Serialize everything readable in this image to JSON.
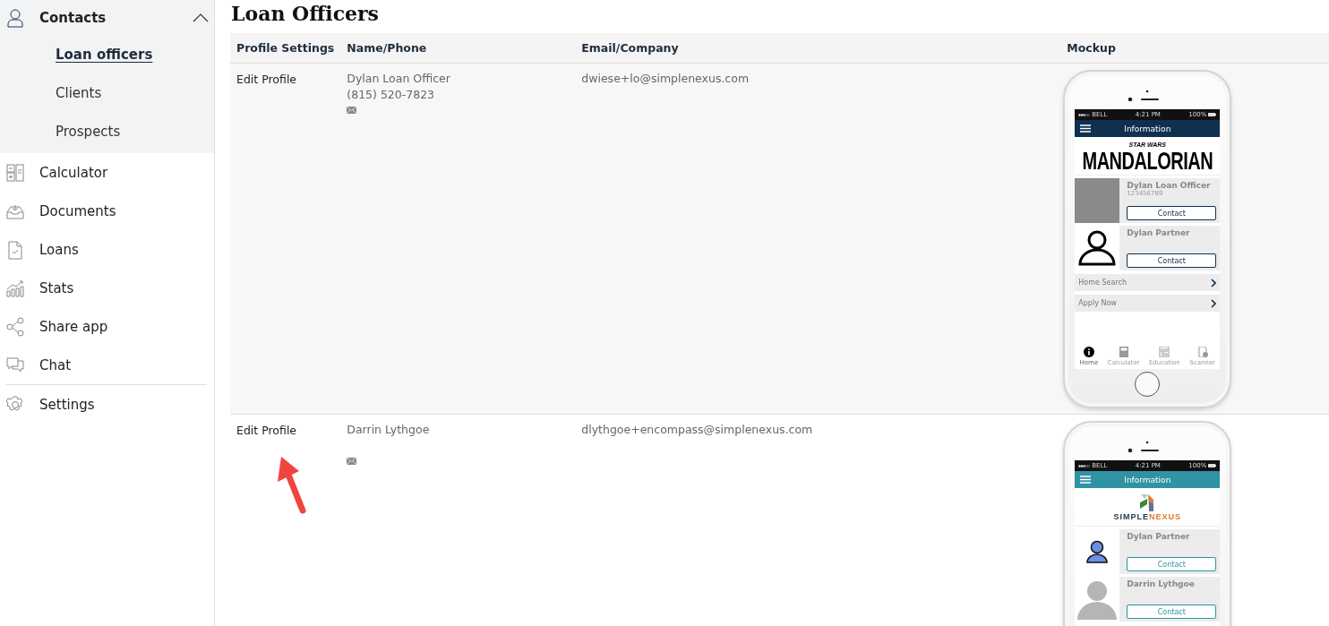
{
  "sidebar": {
    "items": [
      {
        "label": "Contacts",
        "expanded": true,
        "children": [
          {
            "label": "Loan officers",
            "selected": true
          },
          {
            "label": "Clients",
            "selected": false
          },
          {
            "label": "Prospects",
            "selected": false
          }
        ]
      },
      {
        "label": "Calculator"
      },
      {
        "label": "Documents"
      },
      {
        "label": "Loans"
      },
      {
        "label": "Stats"
      },
      {
        "label": "Share app"
      },
      {
        "label": "Chat"
      },
      {
        "label": "Settings"
      }
    ]
  },
  "page": {
    "title": "Loan Officers"
  },
  "table": {
    "columns": [
      "Profile Settings",
      "Name/Phone",
      "Email/Company",
      "Mockup"
    ],
    "rows": [
      {
        "action": "Edit Profile",
        "name": "Dylan Loan Officer",
        "phone": "(815) 520-7823",
        "email": "dwiese+lo@simplenexus.com",
        "mockup": {
          "carrier": "BELL",
          "time": "4:21 PM",
          "battery": "100%",
          "header_title": "Information",
          "color": "#10304f",
          "logo": {
            "kind": "wordmark",
            "small": "STAR WARS",
            "big": "MANDALORIAN"
          },
          "contacts": [
            {
              "kind": "photo",
              "name": "Dylan Loan Officer",
              "phone": "123456789",
              "button": "Contact"
            },
            {
              "kind": "outline",
              "name": "Dylan Partner",
              "button": "Contact"
            }
          ],
          "links": [
            "Home Search",
            "Apply Now"
          ],
          "tabs": [
            {
              "label": "Home",
              "selected": true
            },
            {
              "label": "Calculator",
              "selected": false
            },
            {
              "label": "Education",
              "selected": false
            },
            {
              "label": "Scanner",
              "selected": false
            }
          ]
        }
      },
      {
        "action": "Edit Profile",
        "name": "Darrin Lythgoe",
        "email": "dlythgoe+encompass@simplenexus.com",
        "mockup": {
          "carrier": "BELL",
          "time": "4:21 PM",
          "battery": "100%",
          "header_title": "Information",
          "color": "#2f93a3",
          "logo": {
            "kind": "brand",
            "first": "SIMPLE",
            "second": "NEXUS"
          },
          "contacts": [
            {
              "kind": "person",
              "name": "Dylan Partner",
              "button": "Contact"
            },
            {
              "kind": "silhouette",
              "name": "Darrin Lythgoe",
              "button": "Contact"
            }
          ]
        }
      }
    ]
  }
}
